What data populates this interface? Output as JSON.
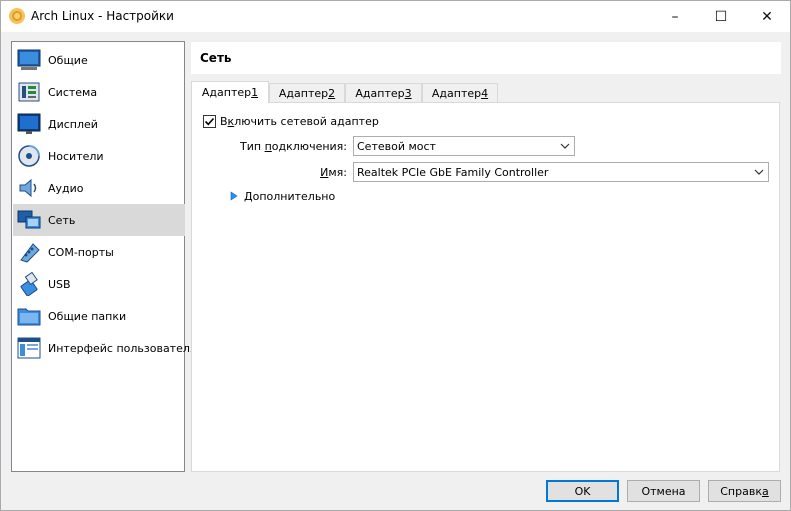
{
  "window": {
    "title": "Arch Linux - Настройки",
    "controls": [
      "–",
      "☐",
      "✕"
    ]
  },
  "sidebar": {
    "items": [
      {
        "label": "Общие",
        "icon": "general-icon"
      },
      {
        "label": "Система",
        "icon": "system-icon"
      },
      {
        "label": "Дисплей",
        "icon": "display-icon"
      },
      {
        "label": "Носители",
        "icon": "storage-icon"
      },
      {
        "label": "Аудио",
        "icon": "audio-icon"
      },
      {
        "label": "Сеть",
        "icon": "network-icon",
        "selected": true
      },
      {
        "label": "COM-порты",
        "icon": "serial-ports-icon"
      },
      {
        "label": "USB",
        "icon": "usb-icon"
      },
      {
        "label": "Общие папки",
        "icon": "shared-folders-icon"
      },
      {
        "label": "Интерфейс пользователя",
        "icon": "user-interface-icon"
      }
    ]
  },
  "header": {
    "title": "Сеть"
  },
  "tabs": [
    {
      "label": "Адаптер ",
      "key": "1",
      "active": true
    },
    {
      "label": "Адаптер ",
      "key": "2"
    },
    {
      "label": "Адаптер ",
      "key": "3"
    },
    {
      "label": "Адаптер ",
      "key": "4"
    }
  ],
  "adapter": {
    "enable_pre": "В",
    "enable_ul": "к",
    "enable_post": "лючить сетевой адаптер",
    "enabled": true,
    "attach_label_pre": "Тип ",
    "attach_label_ul": "п",
    "attach_label_post": "одключения:",
    "attach_value": "Сетевой мост",
    "name_label_ul": "И",
    "name_label_post": "мя:",
    "name_value": "Realtek PCIe GbE Family Controller",
    "advanced_ul": "Д",
    "advanced_post": "ополнительно"
  },
  "buttons": {
    "ok": "OK",
    "cancel": "Отмена",
    "help_pre": "Справк",
    "help_ul": "а"
  },
  "colors": {
    "accent": "#0078d7",
    "selected_row": "#d9d9d9",
    "advanced_arrow": "#1e90ff"
  }
}
